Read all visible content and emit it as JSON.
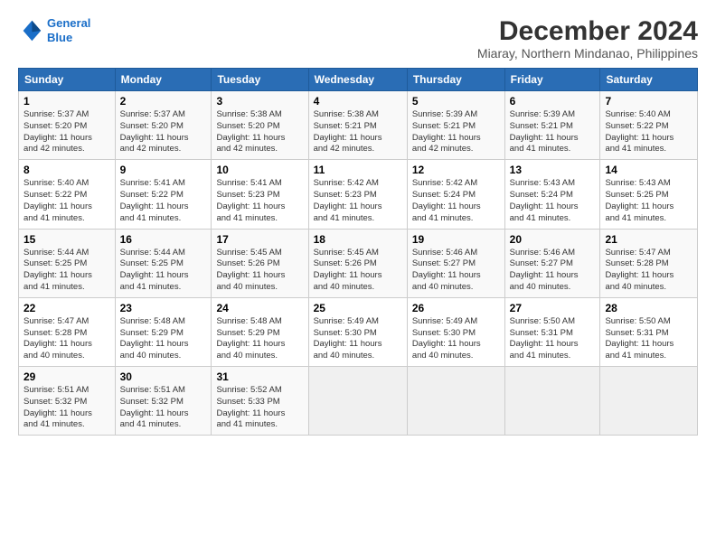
{
  "header": {
    "logo_line1": "General",
    "logo_line2": "Blue",
    "title": "December 2024",
    "location": "Miaray, Northern Mindanao, Philippines"
  },
  "days_of_week": [
    "Sunday",
    "Monday",
    "Tuesday",
    "Wednesday",
    "Thursday",
    "Friday",
    "Saturday"
  ],
  "weeks": [
    [
      {
        "day": "1",
        "info": "Sunrise: 5:37 AM\nSunset: 5:20 PM\nDaylight: 11 hours\nand 42 minutes."
      },
      {
        "day": "2",
        "info": "Sunrise: 5:37 AM\nSunset: 5:20 PM\nDaylight: 11 hours\nand 42 minutes."
      },
      {
        "day": "3",
        "info": "Sunrise: 5:38 AM\nSunset: 5:20 PM\nDaylight: 11 hours\nand 42 minutes."
      },
      {
        "day": "4",
        "info": "Sunrise: 5:38 AM\nSunset: 5:21 PM\nDaylight: 11 hours\nand 42 minutes."
      },
      {
        "day": "5",
        "info": "Sunrise: 5:39 AM\nSunset: 5:21 PM\nDaylight: 11 hours\nand 42 minutes."
      },
      {
        "day": "6",
        "info": "Sunrise: 5:39 AM\nSunset: 5:21 PM\nDaylight: 11 hours\nand 41 minutes."
      },
      {
        "day": "7",
        "info": "Sunrise: 5:40 AM\nSunset: 5:22 PM\nDaylight: 11 hours\nand 41 minutes."
      }
    ],
    [
      {
        "day": "8",
        "info": "Sunrise: 5:40 AM\nSunset: 5:22 PM\nDaylight: 11 hours\nand 41 minutes."
      },
      {
        "day": "9",
        "info": "Sunrise: 5:41 AM\nSunset: 5:22 PM\nDaylight: 11 hours\nand 41 minutes."
      },
      {
        "day": "10",
        "info": "Sunrise: 5:41 AM\nSunset: 5:23 PM\nDaylight: 11 hours\nand 41 minutes."
      },
      {
        "day": "11",
        "info": "Sunrise: 5:42 AM\nSunset: 5:23 PM\nDaylight: 11 hours\nand 41 minutes."
      },
      {
        "day": "12",
        "info": "Sunrise: 5:42 AM\nSunset: 5:24 PM\nDaylight: 11 hours\nand 41 minutes."
      },
      {
        "day": "13",
        "info": "Sunrise: 5:43 AM\nSunset: 5:24 PM\nDaylight: 11 hours\nand 41 minutes."
      },
      {
        "day": "14",
        "info": "Sunrise: 5:43 AM\nSunset: 5:25 PM\nDaylight: 11 hours\nand 41 minutes."
      }
    ],
    [
      {
        "day": "15",
        "info": "Sunrise: 5:44 AM\nSunset: 5:25 PM\nDaylight: 11 hours\nand 41 minutes."
      },
      {
        "day": "16",
        "info": "Sunrise: 5:44 AM\nSunset: 5:25 PM\nDaylight: 11 hours\nand 41 minutes."
      },
      {
        "day": "17",
        "info": "Sunrise: 5:45 AM\nSunset: 5:26 PM\nDaylight: 11 hours\nand 40 minutes."
      },
      {
        "day": "18",
        "info": "Sunrise: 5:45 AM\nSunset: 5:26 PM\nDaylight: 11 hours\nand 40 minutes."
      },
      {
        "day": "19",
        "info": "Sunrise: 5:46 AM\nSunset: 5:27 PM\nDaylight: 11 hours\nand 40 minutes."
      },
      {
        "day": "20",
        "info": "Sunrise: 5:46 AM\nSunset: 5:27 PM\nDaylight: 11 hours\nand 40 minutes."
      },
      {
        "day": "21",
        "info": "Sunrise: 5:47 AM\nSunset: 5:28 PM\nDaylight: 11 hours\nand 40 minutes."
      }
    ],
    [
      {
        "day": "22",
        "info": "Sunrise: 5:47 AM\nSunset: 5:28 PM\nDaylight: 11 hours\nand 40 minutes."
      },
      {
        "day": "23",
        "info": "Sunrise: 5:48 AM\nSunset: 5:29 PM\nDaylight: 11 hours\nand 40 minutes."
      },
      {
        "day": "24",
        "info": "Sunrise: 5:48 AM\nSunset: 5:29 PM\nDaylight: 11 hours\nand 40 minutes."
      },
      {
        "day": "25",
        "info": "Sunrise: 5:49 AM\nSunset: 5:30 PM\nDaylight: 11 hours\nand 40 minutes."
      },
      {
        "day": "26",
        "info": "Sunrise: 5:49 AM\nSunset: 5:30 PM\nDaylight: 11 hours\nand 40 minutes."
      },
      {
        "day": "27",
        "info": "Sunrise: 5:50 AM\nSunset: 5:31 PM\nDaylight: 11 hours\nand 41 minutes."
      },
      {
        "day": "28",
        "info": "Sunrise: 5:50 AM\nSunset: 5:31 PM\nDaylight: 11 hours\nand 41 minutes."
      }
    ],
    [
      {
        "day": "29",
        "info": "Sunrise: 5:51 AM\nSunset: 5:32 PM\nDaylight: 11 hours\nand 41 minutes."
      },
      {
        "day": "30",
        "info": "Sunrise: 5:51 AM\nSunset: 5:32 PM\nDaylight: 11 hours\nand 41 minutes."
      },
      {
        "day": "31",
        "info": "Sunrise: 5:52 AM\nSunset: 5:33 PM\nDaylight: 11 hours\nand 41 minutes."
      },
      {
        "day": "",
        "info": ""
      },
      {
        "day": "",
        "info": ""
      },
      {
        "day": "",
        "info": ""
      },
      {
        "day": "",
        "info": ""
      }
    ]
  ]
}
